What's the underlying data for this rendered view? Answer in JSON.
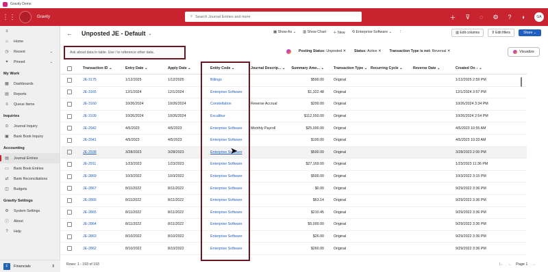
{
  "window": {
    "title": "Gravity Demo"
  },
  "app": {
    "name": "Gravity",
    "search_placeholder": "Search Journal Entries and more",
    "avatar": "GA"
  },
  "sidebar": {
    "items_top": [
      {
        "label": "Home",
        "icon": "home-icon",
        "glyph": "⌂"
      },
      {
        "label": "Recent",
        "icon": "clock-icon",
        "glyph": "◷",
        "chevron": "⌄"
      },
      {
        "label": "Pinned",
        "icon": "pin-icon",
        "glyph": "✦",
        "chevron": "⌄"
      }
    ],
    "section_mywork": "My Work",
    "items_mywork": [
      {
        "label": "Dashboards",
        "icon": "dashboard-icon",
        "glyph": "▦"
      },
      {
        "label": "Reports",
        "icon": "report-icon",
        "glyph": "▤"
      },
      {
        "label": "Queue Items",
        "icon": "queue-icon",
        "glyph": "≡"
      }
    ],
    "section_inquiries": "Inquiries",
    "items_inquiries": [
      {
        "label": "Journal Inquiry",
        "icon": "journal-inquiry-icon",
        "glyph": "⊙"
      },
      {
        "label": "Bank Book Inquiry",
        "icon": "bank-book-inquiry-icon",
        "glyph": "▣"
      }
    ],
    "section_accounting": "Accounting",
    "items_accounting": [
      {
        "label": "Journal Entries",
        "icon": "journal-entries-icon",
        "glyph": "▤",
        "active": true
      },
      {
        "label": "Bank Book Entries",
        "icon": "bank-book-entries-icon",
        "glyph": "▭"
      },
      {
        "label": "Bank Reconciliations",
        "icon": "bank-recon-icon",
        "glyph": "⇄"
      },
      {
        "label": "Budgets",
        "icon": "budget-icon",
        "glyph": "◫"
      }
    ],
    "section_settings": "Gravity Settings",
    "items_settings": [
      {
        "label": "System Settings",
        "icon": "gear-icon",
        "glyph": "⚙"
      },
      {
        "label": "About",
        "icon": "info-icon",
        "glyph": "ⓘ"
      },
      {
        "label": "Help",
        "icon": "help-icon",
        "glyph": "?"
      }
    ],
    "area_badge": "F",
    "area_label": "Financials"
  },
  "header": {
    "title": "Unposted JE - Default",
    "show_as": "Show As",
    "show_chart": "Show Chart",
    "new": "New",
    "enterprise_software": "Enterprise Software",
    "edit_columns": "Edit columns",
    "edit_filters": "Edit filters",
    "share": "Share"
  },
  "filters": {
    "ask_placeholder": "Ask about data in table. Use / to reference other data.",
    "chips": [
      {
        "key": "Posting Status:",
        "value": "Unposted"
      },
      {
        "key": "Status:",
        "value": "Active"
      },
      {
        "key": "Transaction Type is not:",
        "value": "Reversal"
      }
    ],
    "visualize": "Visualize"
  },
  "table": {
    "columns": [
      "Transaction ID",
      "Entry Date",
      "Apply Date",
      "Entity Code",
      "Journal Descrip...",
      "Summary Amo...",
      "Transaction Type",
      "Recurring Cycle",
      "Reverse Date",
      "Created On"
    ],
    "rows": [
      [
        "JE-3175",
        "1/12/2025",
        "1/12/2025",
        "Billings",
        "",
        "$500.00",
        "Original",
        "",
        "",
        "1/12/2025 2:59 PM"
      ],
      [
        "JE-3165",
        "12/1/2024",
        "12/1/2024",
        "Enterprise Software",
        "",
        "$1,322.48",
        "Original",
        "",
        "",
        "12/1/2024 3:57 PM"
      ],
      [
        "JE-3160",
        "10/26/2024",
        "10/26/2024",
        "Constellation",
        "Reverse Accrual",
        "$200.00",
        "Original",
        "",
        "",
        "10/26/2024 3:34 PM"
      ],
      [
        "JE-3109",
        "10/26/2024",
        "10/26/2024",
        "Excalibur",
        "",
        "$112,550.00",
        "Original",
        "",
        "",
        "10/26/2024 2:54 PM"
      ],
      [
        "JE-2942",
        "4/5/2023",
        "4/5/2023",
        "Enterprise Software",
        "Monthly Payroll",
        "$25,000.00",
        "Original",
        "",
        "",
        "4/5/2023 10:55 AM"
      ],
      [
        "JE-2941",
        "4/5/2023",
        "4/5/2023",
        "Enterprise Software",
        "",
        "$100.00",
        "Original",
        "",
        "",
        "4/5/2023 10:33 AM"
      ],
      [
        "JE-2938",
        "3/28/2023",
        "3/28/2023",
        "Enterprise Software",
        "",
        "$500.00",
        "Original",
        "",
        "",
        "3/28/2023 2:00 PM"
      ],
      [
        "JE-2911",
        "1/23/2023",
        "1/23/2023",
        "Enterprise Software",
        "",
        "$27,169.00",
        "Original",
        "",
        "",
        "1/23/2023 11:36 PM"
      ],
      [
        "JE-2869",
        "10/3/2022",
        "10/3/2022",
        "Enterprise Software",
        "",
        "$500.00",
        "Original",
        "",
        "",
        "10/3/2022 3:15 PM"
      ],
      [
        "JE-2867",
        "8/11/2022",
        "8/11/2022",
        "Enterprise Software",
        "",
        "$0.00",
        "Original",
        "",
        "",
        "9/29/2022 3:36 PM"
      ],
      [
        "JE-2866",
        "8/11/2022",
        "8/11/2022",
        "Enterprise Software",
        "",
        "$63.14",
        "Original",
        "",
        "",
        "9/29/2022 3:36 PM"
      ],
      [
        "JE-2865",
        "8/11/2022",
        "8/11/2022",
        "Enterprise Software",
        "",
        "$210.45",
        "Original",
        "",
        "",
        "9/29/2022 3:36 PM"
      ],
      [
        "JE-2864",
        "8/11/2022",
        "8/11/2022",
        "Enterprise Software",
        "",
        "$5,000.00",
        "Original",
        "",
        "",
        "9/29/2022 3:36 PM"
      ],
      [
        "JE-2863",
        "8/10/2022",
        "8/10/2022",
        "Enterprise Software",
        "",
        "$26.00",
        "Original",
        "",
        "",
        "9/29/2022 3:36 PM"
      ],
      [
        "JE-2862",
        "8/10/2022",
        "8/10/2022",
        "Enterprise Software",
        "",
        "$260.00",
        "Original",
        "",
        "",
        "9/29/2022 3:36 PM"
      ]
    ],
    "footer": "Rows: 1 - 193 of 193",
    "page_label": "Page 1"
  },
  "colors": {
    "brand": "#c8242f",
    "highlight_box": "#6b1520",
    "link": "#1f5fbf"
  }
}
